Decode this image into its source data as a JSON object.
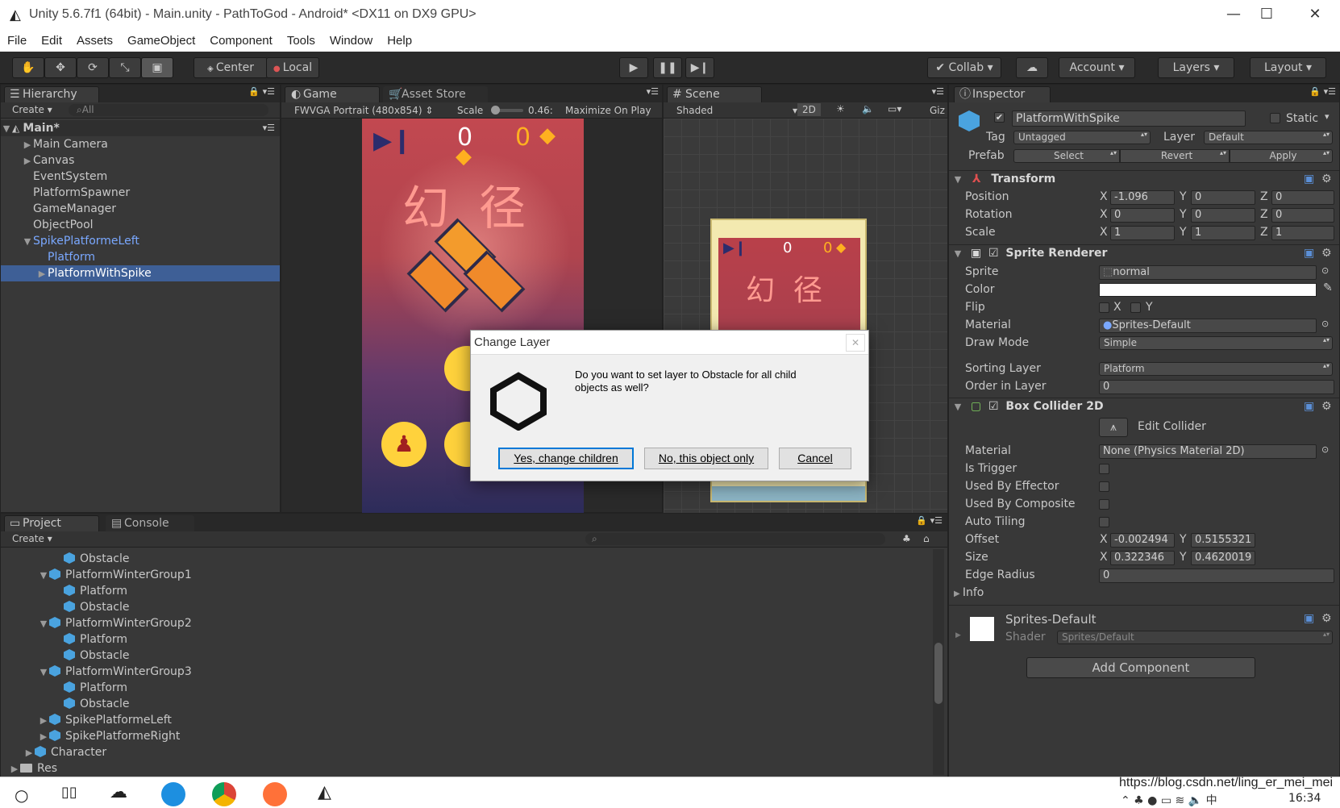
{
  "window": {
    "title": "Unity 5.6.7f1 (64bit) - Main.unity - PathToGod - Android* <DX11 on DX9 GPU>"
  },
  "menu": [
    "File",
    "Edit",
    "Assets",
    "GameObject",
    "Component",
    "Tools",
    "Window",
    "Help"
  ],
  "toolbar": {
    "pivot": "Center",
    "space": "Local",
    "collab": "Collab",
    "account": "Account",
    "layers": "Layers",
    "layout": "Layout"
  },
  "hierarchy": {
    "tab": "Hierarchy",
    "create": "Create",
    "search_placeholder": "All",
    "scene": "Main*",
    "items": [
      {
        "label": "Main Camera",
        "indent": 1,
        "tri": "right"
      },
      {
        "label": "Canvas",
        "indent": 1,
        "tri": "right"
      },
      {
        "label": "EventSystem",
        "indent": 1,
        "tri": ""
      },
      {
        "label": "PlatformSpawner",
        "indent": 1,
        "tri": ""
      },
      {
        "label": "GameManager",
        "indent": 1,
        "tri": ""
      },
      {
        "label": "ObjectPool",
        "indent": 1,
        "tri": ""
      },
      {
        "label": "SpikePlatformeLeft",
        "indent": 1,
        "tri": "down",
        "style": "blue"
      },
      {
        "label": "Platform",
        "indent": 2,
        "tri": "",
        "style": "blue"
      },
      {
        "label": "PlatformWithSpike",
        "indent": 2,
        "tri": "right",
        "style": "sel"
      }
    ]
  },
  "game": {
    "tab": "Game",
    "tab2": "Asset Store",
    "resolution": "FWVGA Portrait (480x854)",
    "scale_label": "Scale",
    "scale_value": "0.46",
    "maximize": "Maximize On Play",
    "score": "0",
    "gems": "0",
    "title_cn": "幻  径"
  },
  "scene": {
    "tab": "Scene",
    "shading": "Shaded",
    "mode2d": "2D",
    "gizmos": "Giz",
    "score": "0",
    "gems": "0",
    "title_cn": "幻  径"
  },
  "inspector": {
    "tab": "Inspector",
    "object_name": "PlatformWithSpike",
    "static_label": "Static",
    "tag_label": "Tag",
    "tag_value": "Untagged",
    "layer_label": "Layer",
    "layer_value": "Default",
    "prefab_label": "Prefab",
    "prefab_select": "Select",
    "prefab_revert": "Revert",
    "prefab_apply": "Apply",
    "transform": {
      "title": "Transform",
      "position_label": "Position",
      "pos_x": "-1.096",
      "pos_y": "0",
      "pos_z": "0",
      "rotation_label": "Rotation",
      "rot_x": "0",
      "rot_y": "0",
      "rot_z": "0",
      "scale_label": "Scale",
      "scl_x": "1",
      "scl_y": "1",
      "scl_z": "1"
    },
    "sprite_renderer": {
      "title": "Sprite Renderer",
      "sprite_label": "Sprite",
      "sprite_value": "normal",
      "color_label": "Color",
      "flip_label": "Flip",
      "flip_x": "X",
      "flip_y": "Y",
      "material_label": "Material",
      "material_value": "Sprites-Default",
      "drawmode_label": "Draw Mode",
      "drawmode_value": "Simple",
      "sorting_label": "Sorting Layer",
      "sorting_value": "Platform",
      "order_label": "Order in Layer",
      "order_value": "0"
    },
    "box_collider": {
      "title": "Box Collider 2D",
      "edit_collider": "Edit Collider",
      "material_label": "Material",
      "material_value": "None (Physics Material 2D)",
      "trigger_label": "Is Trigger",
      "effector_label": "Used By Effector",
      "composite_label": "Used By Composite",
      "autotiling_label": "Auto Tiling",
      "offset_label": "Offset",
      "offset_x": "-0.002494",
      "offset_y": "0.5155321",
      "size_label": "Size",
      "size_x": "0.322346",
      "size_y": "0.4620019",
      "edge_label": "Edge Radius",
      "edge_value": "0",
      "info_label": "Info"
    },
    "material_block": {
      "name": "Sprites-Default",
      "shader_label": "Shader",
      "shader_value": "Sprites/Default"
    },
    "add_component": "Add Component"
  },
  "project": {
    "tab": "Project",
    "tab2": "Console",
    "create": "Create",
    "items": [
      {
        "label": "Obstacle",
        "indent": 4,
        "tri": "",
        "icon": "cube"
      },
      {
        "label": "PlatformWinterGroup1",
        "indent": 3,
        "tri": "down",
        "icon": "cube"
      },
      {
        "label": "Platform",
        "indent": 4,
        "tri": "",
        "icon": "cube"
      },
      {
        "label": "Obstacle",
        "indent": 4,
        "tri": "",
        "icon": "cube"
      },
      {
        "label": "PlatformWinterGroup2",
        "indent": 3,
        "tri": "down",
        "icon": "cube"
      },
      {
        "label": "Platform",
        "indent": 4,
        "tri": "",
        "icon": "cube"
      },
      {
        "label": "Obstacle",
        "indent": 4,
        "tri": "",
        "icon": "cube"
      },
      {
        "label": "PlatformWinterGroup3",
        "indent": 3,
        "tri": "down",
        "icon": "cube"
      },
      {
        "label": "Platform",
        "indent": 4,
        "tri": "",
        "icon": "cube"
      },
      {
        "label": "Obstacle",
        "indent": 4,
        "tri": "",
        "icon": "cube"
      },
      {
        "label": "SpikePlatformeLeft",
        "indent": 3,
        "tri": "right",
        "icon": "cube"
      },
      {
        "label": "SpikePlatformeRight",
        "indent": 3,
        "tri": "right",
        "icon": "cube"
      },
      {
        "label": "Character",
        "indent": 2,
        "tri": "right",
        "icon": "cube"
      },
      {
        "label": "Res",
        "indent": 1,
        "tri": "right",
        "icon": "folder"
      }
    ]
  },
  "dialog": {
    "title": "Change Layer",
    "message": "Do you want to set layer to Obstacle for all child objects as well?",
    "yes": "Yes, change children",
    "no": "No, this object only",
    "cancel": "Cancel"
  },
  "taskbar": {
    "url": "https://blog.csdn.net/ling_er_mei_mei",
    "time": "16:34"
  }
}
